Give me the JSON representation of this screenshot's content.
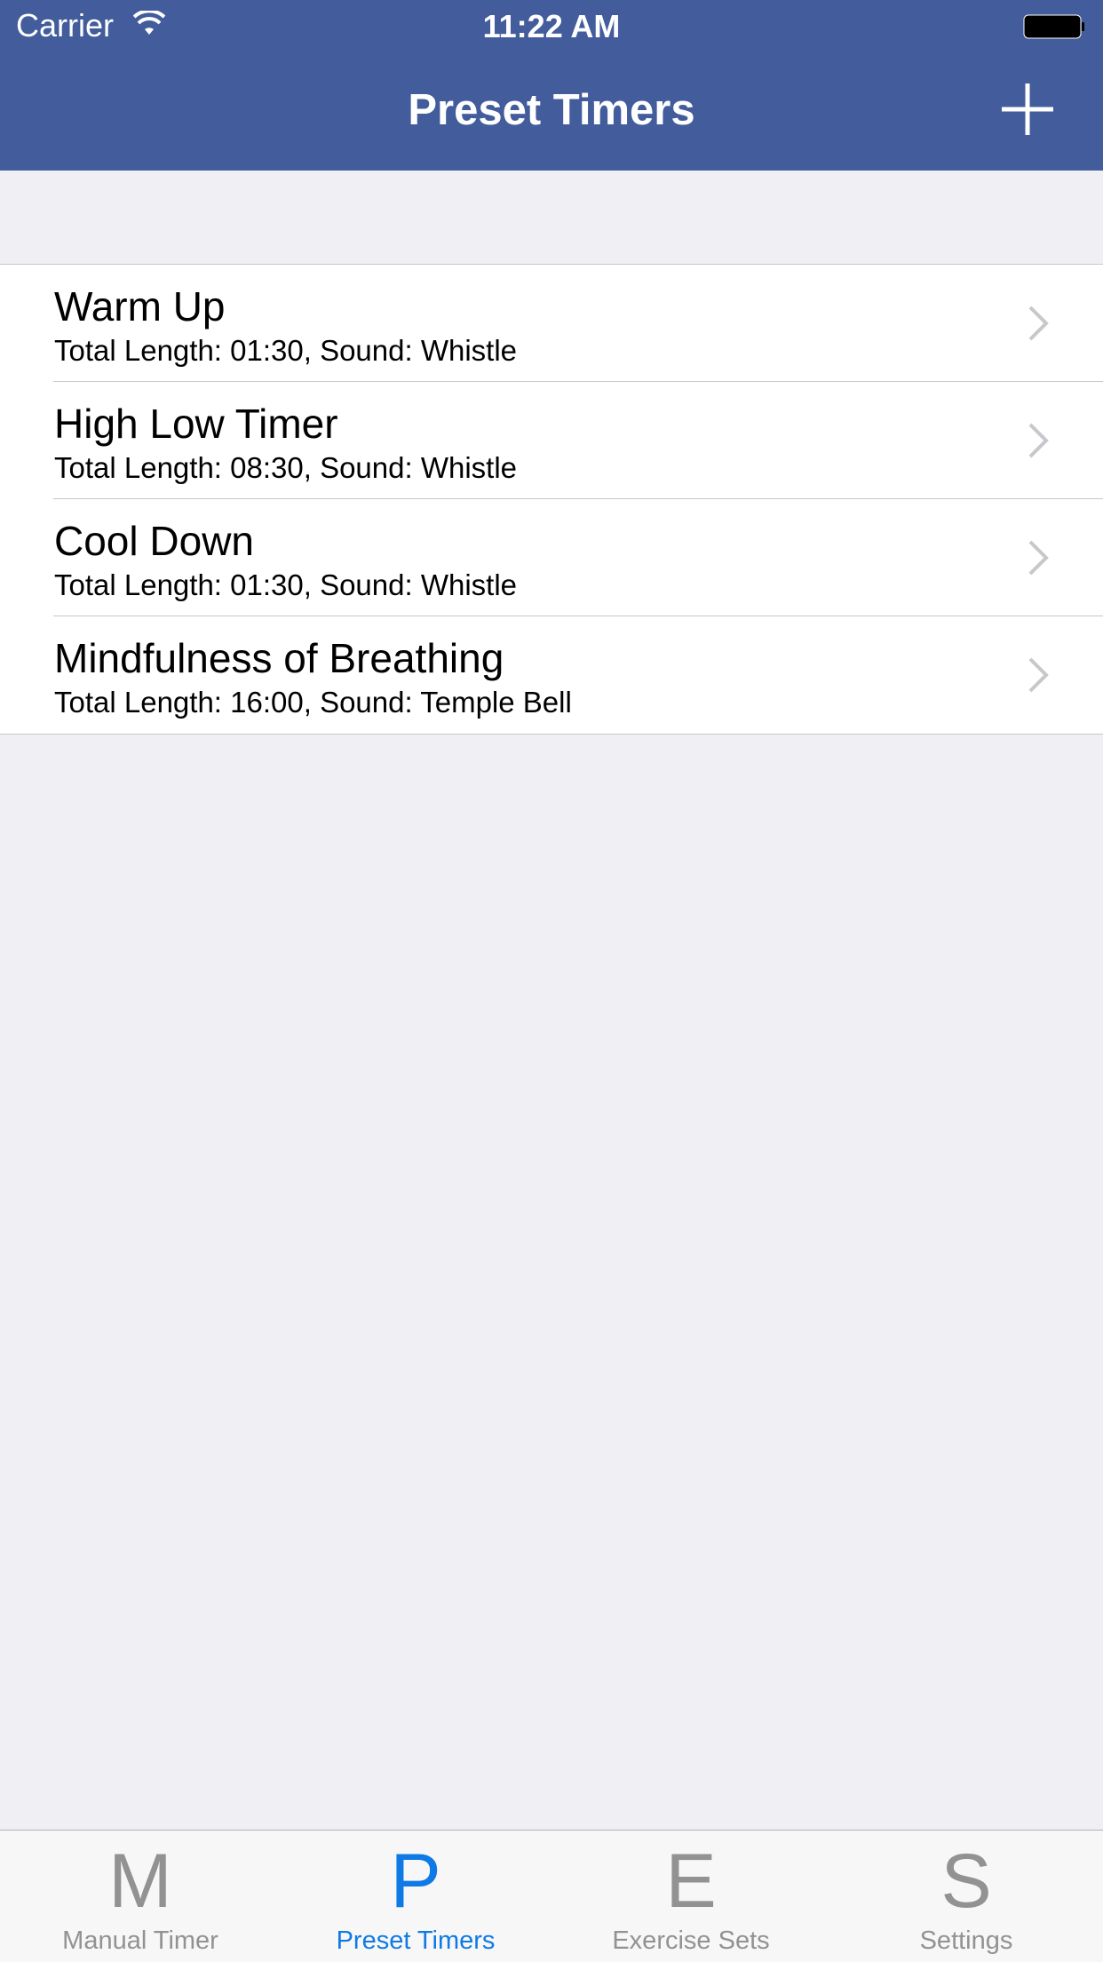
{
  "status_bar": {
    "carrier": "Carrier",
    "time": "11:22 AM"
  },
  "nav": {
    "title": "Preset Timers",
    "add_icon": "plus-icon"
  },
  "timers": [
    {
      "title": "Warm Up",
      "subtitle": "Total Length: 01:30, Sound: Whistle"
    },
    {
      "title": "High Low Timer",
      "subtitle": "Total Length: 08:30, Sound: Whistle"
    },
    {
      "title": "Cool Down",
      "subtitle": "Total Length: 01:30, Sound: Whistle"
    },
    {
      "title": "Mindfulness of Breathing",
      "subtitle": "Total Length: 16:00, Sound: Temple Bell"
    }
  ],
  "tabs": [
    {
      "glyph": "M",
      "label": "Manual Timer",
      "active": false
    },
    {
      "glyph": "P",
      "label": "Preset Timers",
      "active": true
    },
    {
      "glyph": "E",
      "label": "Exercise Sets",
      "active": false
    },
    {
      "glyph": "S",
      "label": "Settings",
      "active": false
    }
  ],
  "colors": {
    "nav_bar": "#425c9c",
    "tab_active": "#0f7ae5",
    "tab_inactive": "#929292",
    "background": "#efeff4"
  }
}
